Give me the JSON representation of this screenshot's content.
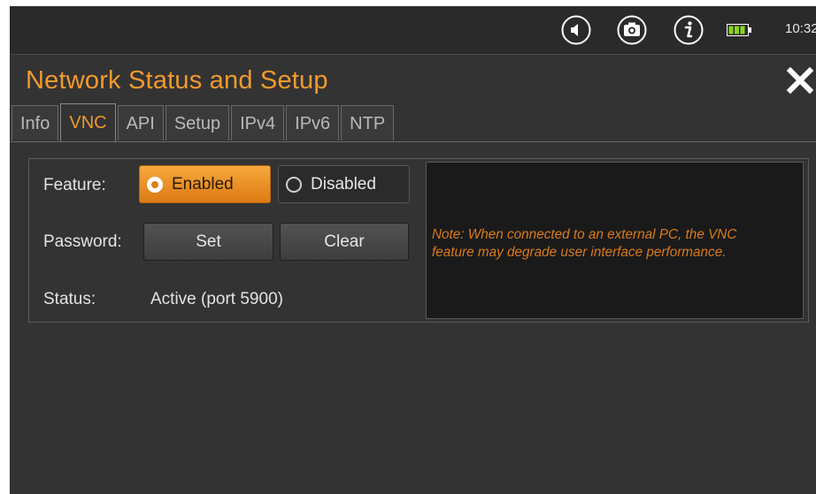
{
  "statusbar": {
    "icons": [
      "speaker-icon",
      "camera-icon",
      "info-icon",
      "battery-icon"
    ],
    "time": "10:32"
  },
  "dialog": {
    "title": "Network Status and Setup",
    "close_icon": "close-icon"
  },
  "tabs": [
    {
      "label": "Info",
      "active": false
    },
    {
      "label": "VNC",
      "active": true
    },
    {
      "label": "API",
      "active": false
    },
    {
      "label": "Setup",
      "active": false
    },
    {
      "label": "IPv4",
      "active": false
    },
    {
      "label": "IPv6",
      "active": false
    },
    {
      "label": "NTP",
      "active": false
    }
  ],
  "vnc": {
    "feature_label": "Feature:",
    "feature_options": [
      {
        "label": "Enabled",
        "selected": true
      },
      {
        "label": "Disabled",
        "selected": false
      }
    ],
    "password_label": "Password:",
    "set_button": "Set",
    "clear_button": "Clear",
    "status_label": "Status:",
    "status_value": "Active (port 5900)",
    "note_line1": "Note: When connected to an external PC, the VNC",
    "note_line2": "feature may degrade user interface performance."
  },
  "colors": {
    "accent": "#f29a2e",
    "background": "#333333",
    "note_text": "#d97a1c"
  }
}
